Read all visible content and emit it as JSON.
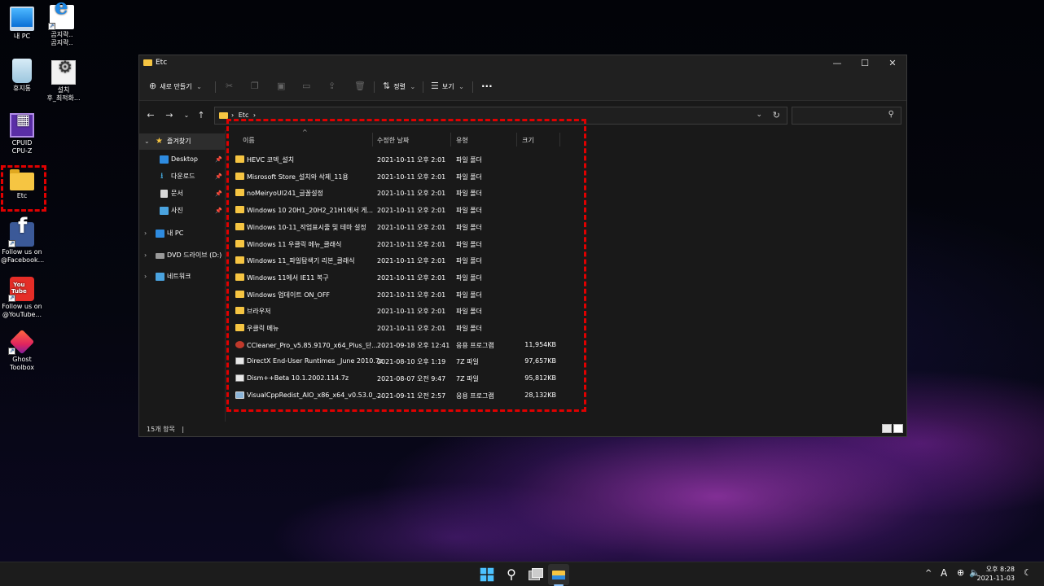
{
  "desktop_icons": [
    {
      "label": "내 PC",
      "icon": "this-pc-icon"
    },
    {
      "label": "곰지락..\n곰지락..",
      "icon": "internet-explorer-icon"
    },
    {
      "label": "휴지통",
      "icon": "recycle-bin-icon"
    },
    {
      "label": "설치\n후_최적화...",
      "icon": "settings-file-icon"
    },
    {
      "label": "CPUID\nCPU-Z",
      "icon": "cpuz-icon"
    },
    {
      "label": "Etc",
      "icon": "folder-icon"
    },
    {
      "label": "Follow us on\n@Facebook...",
      "icon": "facebook-icon"
    },
    {
      "label": "Follow us on\n@YouTube...",
      "icon": "youtube-icon"
    },
    {
      "label": "Ghost\nToolbox",
      "icon": "ghost-toolbox-icon"
    }
  ],
  "window": {
    "title": "Etc",
    "controls": {
      "minimize": "—",
      "maximize": "☐",
      "close": "✕"
    }
  },
  "commandbar": {
    "new_label": "새로 만들기",
    "new_chevron": "⌄",
    "sort_label": "정렬",
    "view_label": "보기",
    "more_label": "···"
  },
  "addressbar": {
    "path": "Etc",
    "separator": "›",
    "search_placeholder": ""
  },
  "navpane": {
    "quick_access": "즐겨찾기",
    "items": [
      {
        "label": "Desktop",
        "icon": "desktop-icon",
        "pinned": true
      },
      {
        "label": "다운로드",
        "icon": "download-icon",
        "pinned": true
      },
      {
        "label": "문서",
        "icon": "documents-icon",
        "pinned": true
      },
      {
        "label": "사진",
        "icon": "pictures-icon",
        "pinned": true
      }
    ],
    "this_pc": "내 PC",
    "dvd": "DVD 드라이브 (D:)",
    "network": "네트워크"
  },
  "columns": {
    "name": "이름",
    "modified": "수정한 날짜",
    "type": "유형",
    "size": "크기"
  },
  "files": [
    {
      "name": "HEVC 코덱_설치",
      "modified": "2021-10-11 오후 2:01",
      "type": "파일 폴더",
      "size": "",
      "kind": "folder"
    },
    {
      "name": "Misrosoft Store_설치와 삭제_11용",
      "modified": "2021-10-11 오후 2:01",
      "type": "파일 폴더",
      "size": "",
      "kind": "folder"
    },
    {
      "name": "noMeiryoUI241_글꼴설정",
      "modified": "2021-10-11 오후 2:01",
      "type": "파일 폴더",
      "size": "",
      "kind": "folder"
    },
    {
      "name": "Windows 10 20H1_20H2_21H1에서 게...",
      "modified": "2021-10-11 오후 2:01",
      "type": "파일 폴더",
      "size": "",
      "kind": "folder"
    },
    {
      "name": "Windows 10-11_작업표시줄 및 테마 설정",
      "modified": "2021-10-11 오후 2:01",
      "type": "파일 폴더",
      "size": "",
      "kind": "folder"
    },
    {
      "name": "Windows 11 우클릭 메뉴_클래식",
      "modified": "2021-10-11 오후 2:01",
      "type": "파일 폴더",
      "size": "",
      "kind": "folder"
    },
    {
      "name": "Windows 11_파일탐색기 리본_클래식",
      "modified": "2021-10-11 오후 2:01",
      "type": "파일 폴더",
      "size": "",
      "kind": "folder"
    },
    {
      "name": "Windows 11에서 IE11 복구",
      "modified": "2021-10-11 오후 2:01",
      "type": "파일 폴더",
      "size": "",
      "kind": "folder"
    },
    {
      "name": "Windows 업데이트 ON_OFF",
      "modified": "2021-10-11 오후 2:01",
      "type": "파일 폴더",
      "size": "",
      "kind": "folder"
    },
    {
      "name": "브라우저",
      "modified": "2021-10-11 오후 2:01",
      "type": "파일 폴더",
      "size": "",
      "kind": "folder"
    },
    {
      "name": "우클릭 메뉴",
      "modified": "2021-10-11 오후 2:01",
      "type": "파일 폴더",
      "size": "",
      "kind": "folder"
    },
    {
      "name": "CCleaner_Pro_v5.85.9170_x64_Plus_단...",
      "modified": "2021-09-18 오후 12:41",
      "type": "응용 프로그램",
      "size": "11,954KB",
      "kind": "app"
    },
    {
      "name": "DirectX End-User Runtimes _June 2010.7z",
      "modified": "2021-08-10 오후 1:19",
      "type": "7Z 파일",
      "size": "97,657KB",
      "kind": "file7z"
    },
    {
      "name": "Dism++Beta 10.1.2002.114.7z",
      "modified": "2021-08-07 오전 9:47",
      "type": "7Z 파일",
      "size": "95,812KB",
      "kind": "file7z"
    },
    {
      "name": "VisualCppRedist_AIO_x86_x64_v0.53.0_...",
      "modified": "2021-09-11 오전 2:57",
      "type": "응용 프로그램",
      "size": "28,132KB",
      "kind": "setupf"
    }
  ],
  "status": {
    "count": "15개 항목",
    "sep": "|"
  },
  "taskbar": {
    "apps": [
      "start-icon",
      "search-icon",
      "task-view-icon",
      "file-explorer-icon"
    ],
    "tray": {
      "chevron": "^",
      "ime": "A"
    },
    "time": "오후 8:28",
    "date": "2021-11-03"
  },
  "colors": {
    "highlight": "#e00000",
    "folder": "#f6c542",
    "accent": "#4cc2ff"
  }
}
